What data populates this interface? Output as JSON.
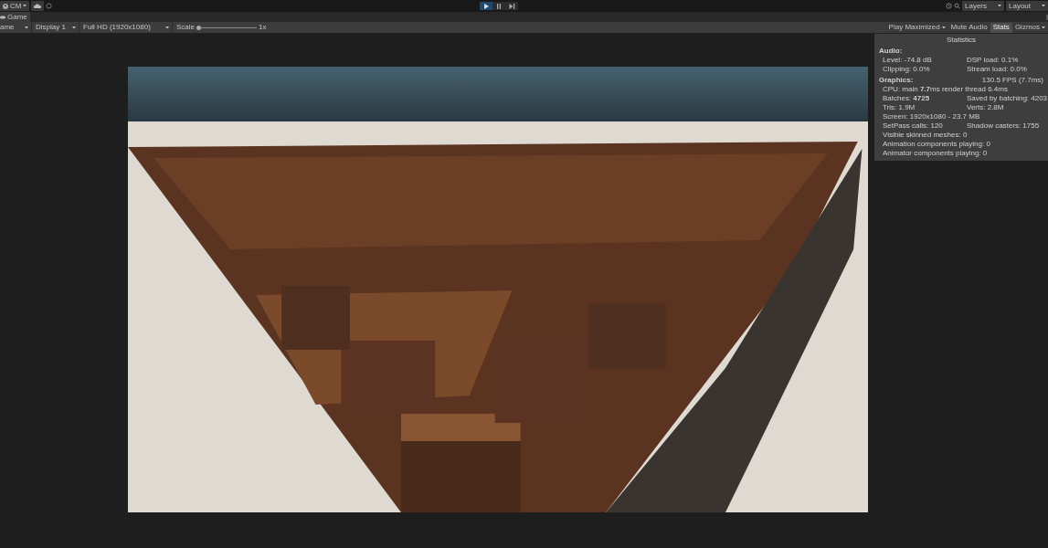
{
  "toolbar": {
    "account": "CM",
    "play_controls": [
      {
        "kind": "play",
        "selected": true
      },
      {
        "kind": "pause",
        "selected": false
      },
      {
        "kind": "step",
        "selected": false
      }
    ],
    "layers": "Layers",
    "layout": "Layout"
  },
  "tab": {
    "label": "Game"
  },
  "game_toolbar": {
    "mode": "ame",
    "display": "Display 1",
    "resolution": "Full HD (1920x1080)",
    "scale_label": "Scale",
    "scale": {
      "level": 0.0
    },
    "scale_value": "1x",
    "toggles": [
      {
        "label": "Play Maximized",
        "kind": "dropdown",
        "on": false
      },
      {
        "label": "Mute Audio",
        "kind": "toggle",
        "on": false
      },
      {
        "label": "Stats",
        "kind": "toggle",
        "on": true
      },
      {
        "label": "Gizmos",
        "kind": "dropdown",
        "on": false
      }
    ]
  },
  "statistics": {
    "title": "Statistics",
    "sections": [
      {
        "heading": "Audio:",
        "rows": [
          [
            "Level: -74.8 dB",
            "DSP load: 0.1%"
          ],
          [
            "Clipping: 0.0%",
            "Stream load: 0.0%"
          ]
        ]
      },
      {
        "heading": "Graphics:",
        "heading_right": "130.5 FPS (7.7ms)",
        "rows": [
          [
            "CPU: main **7.7**ms  render thread 6.4ms"
          ],
          [
            "Batches: **4725**",
            "Saved by batching: 4203"
          ],
          [
            "Tris: 1.9M",
            "Verts: 2.8M"
          ],
          [
            "Screen: 1920x1080 - 23.7 MB"
          ],
          [
            "SetPass calls: 120",
            "Shadow casters: 1755"
          ],
          [
            "Visible skinned meshes: 0"
          ],
          [
            "Animation components playing: 0"
          ],
          [
            "Animator components playing: 0"
          ]
        ]
      }
    ]
  }
}
